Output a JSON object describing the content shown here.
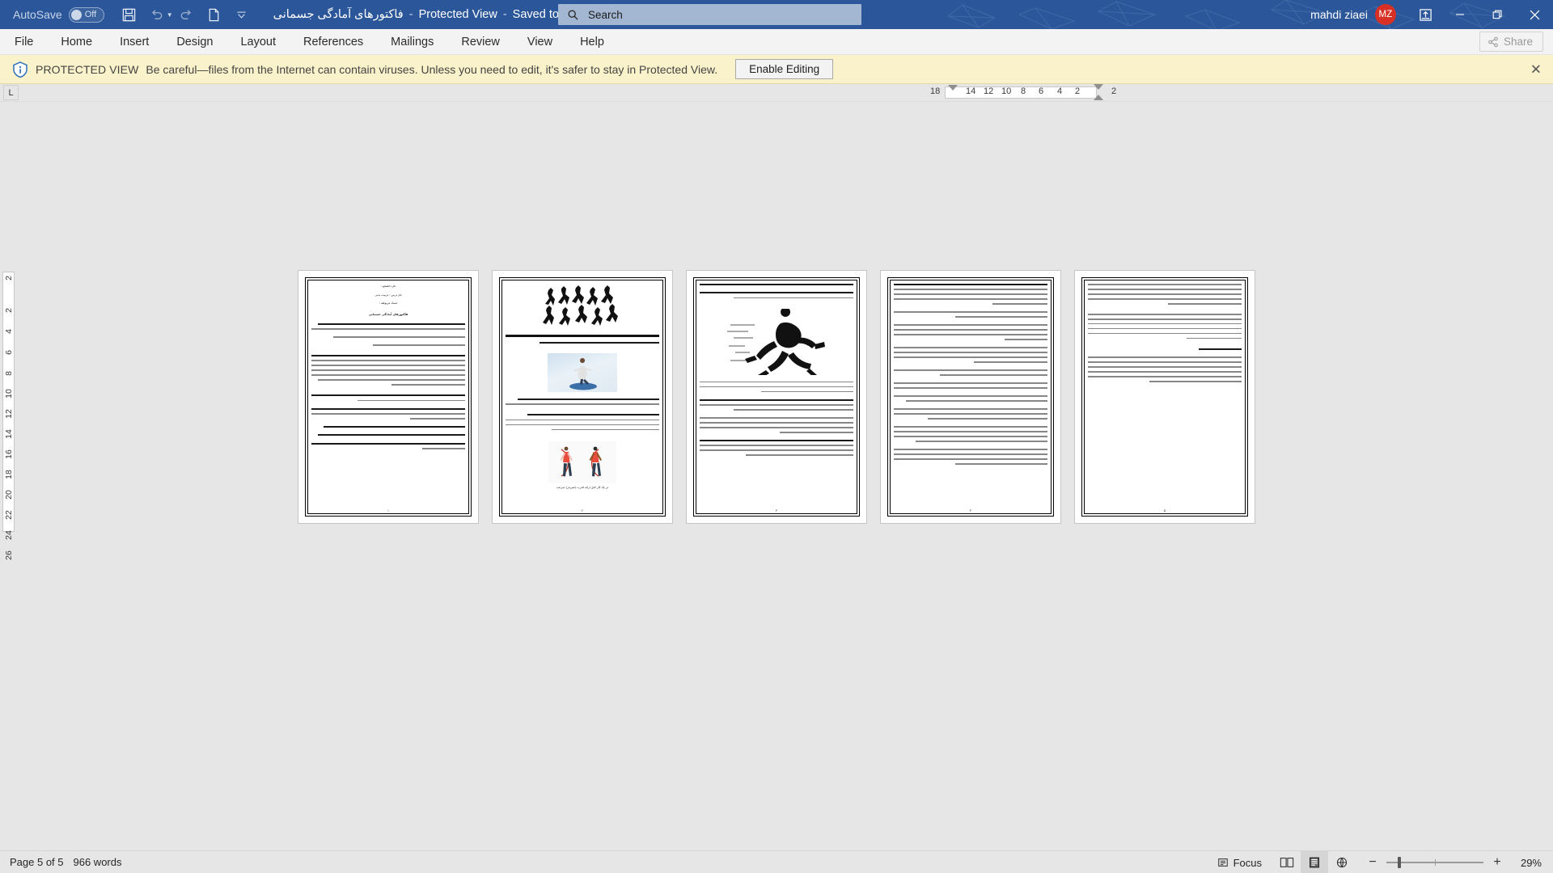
{
  "titlebar": {
    "autosave_label": "AutoSave",
    "autosave_state": "Off",
    "doc_title": "فاکتورهای آمادگی جسمانی",
    "sep1": "-",
    "protected_view": "Protected View",
    "sep2": "-",
    "saved_state": "Saved to this PC",
    "icons": {
      "save": "save-icon",
      "undo": "undo-icon",
      "redo": "redo-icon",
      "new": "new-doc-icon",
      "customize": "customize-quick-access-icon"
    },
    "user_name": "mahdi ziaei",
    "avatar_initials": "MZ",
    "ribbon_display_options": "ribbon-display-options-icon",
    "minimize": "minimize-icon",
    "restore": "restore-icon",
    "close": "close-icon"
  },
  "search": {
    "placeholder": "Search",
    "value": "Search",
    "icon": "search-icon"
  },
  "ribbon": {
    "tabs": [
      {
        "label": "File"
      },
      {
        "label": "Home"
      },
      {
        "label": "Insert"
      },
      {
        "label": "Design"
      },
      {
        "label": "Layout"
      },
      {
        "label": "References"
      },
      {
        "label": "Mailings"
      },
      {
        "label": "Review"
      },
      {
        "label": "View"
      },
      {
        "label": "Help"
      }
    ],
    "share_label": "Share",
    "share_icon": "share-icon"
  },
  "protected_view": {
    "icon": "info-shield-icon",
    "title": "PROTECTED VIEW",
    "message": "Be careful—files from the Internet can contain viruses. Unless you need to edit, it's safer to stay in Protected View.",
    "button_label": "Enable Editing",
    "close_icon": "close-icon"
  },
  "ruler": {
    "tab_stop_marker": "L",
    "horizontal_ticks": [
      "18",
      "14",
      "12",
      "10",
      "8",
      "6",
      "4",
      "2",
      "2"
    ],
    "vertical_ticks": [
      "2",
      "2",
      "4",
      "6",
      "8",
      "10",
      "12",
      "14",
      "16",
      "18",
      "20",
      "22",
      "24",
      "26"
    ]
  },
  "statusbar": {
    "page_info": "Page 5 of 5",
    "word_count": "966 words",
    "focus_label": "Focus",
    "focus_icon": "focus-icon",
    "views": [
      {
        "name": "read-mode",
        "icon": "read-mode-icon",
        "active": false
      },
      {
        "name": "print-layout",
        "icon": "print-layout-icon",
        "active": true
      },
      {
        "name": "web-layout",
        "icon": "web-layout-icon",
        "active": false
      }
    ],
    "zoom_out": "−",
    "zoom_in": "+",
    "zoom_value": "29%"
  },
  "document": {
    "page_count": 5,
    "pages": [
      {
        "number": "1",
        "page_label": "۱",
        "blocks": [
          {
            "type": "text",
            "align": "right",
            "content": "نام دانشجو :"
          },
          {
            "type": "text",
            "align": "right",
            "content": "نام درس : تربیت بدنی"
          },
          {
            "type": "text",
            "align": "right",
            "content": "استاد مربوطه :"
          },
          {
            "type": "heading",
            "align": "right",
            "content": "فاکتورهای آمادگی جسمانی"
          },
          {
            "type": "text",
            "align": "right",
            "content": "قدرت، استقامت، سرعت، انعطاف پذیری، چابکی، تعادل، هماهنگی، توان، زمان عکس العمل"
          },
          {
            "type": "label",
            "align": "right",
            "content": "قدرت عضلانی :"
          },
          {
            "type": "label",
            "align": "right",
            "content": "استقامت عضلانی :"
          },
          {
            "type": "label",
            "align": "right",
            "content": "انعطاف پذیری :"
          },
          {
            "type": "label",
            "align": "right",
            "content": "سرعت :"
          },
          {
            "type": "label",
            "align": "right",
            "content": "چابکی :"
          }
        ]
      },
      {
        "number": "2",
        "page_label": "۲",
        "blocks": [
          {
            "type": "figure",
            "name": "running-silhouettes-figure"
          },
          {
            "type": "label",
            "align": "right",
            "content": "تعادل :"
          },
          {
            "type": "figure",
            "name": "balance-exercise-photo"
          },
          {
            "type": "label",
            "align": "right",
            "content": "هماهنگی :"
          },
          {
            "type": "label",
            "align": "right",
            "content": "توان :"
          },
          {
            "type": "figure",
            "name": "jump-rope-photo"
          },
          {
            "type": "caption",
            "align": "center",
            "content": "در یک کار اتاق ارائه قدرت (ضربدر) سرعت"
          }
        ]
      },
      {
        "number": "3",
        "page_label": "۳",
        "blocks": [
          {
            "type": "label",
            "align": "right",
            "content": "عکس العمل :"
          },
          {
            "type": "label",
            "align": "right",
            "content": "سرعت :"
          },
          {
            "type": "figure",
            "name": "sprinter-figure"
          }
        ]
      },
      {
        "number": "4",
        "page_label": "۴",
        "blocks": [
          {
            "type": "text",
            "align": "right",
            "content": "سیستم اسید لاکتیک"
          },
          {
            "type": "text",
            "align": "right",
            "content": "سیستم هوازی"
          },
          {
            "type": "text",
            "align": "right",
            "content": "ATP-PC فسفاژن"
          }
        ]
      },
      {
        "number": "5",
        "page_label": "۵",
        "blocks": [
          {
            "type": "text",
            "align": "right",
            "content": "۱. تمرین قدرت"
          },
          {
            "type": "text",
            "align": "right",
            "content": "۲. تمرین استقامت"
          }
        ]
      }
    ]
  }
}
